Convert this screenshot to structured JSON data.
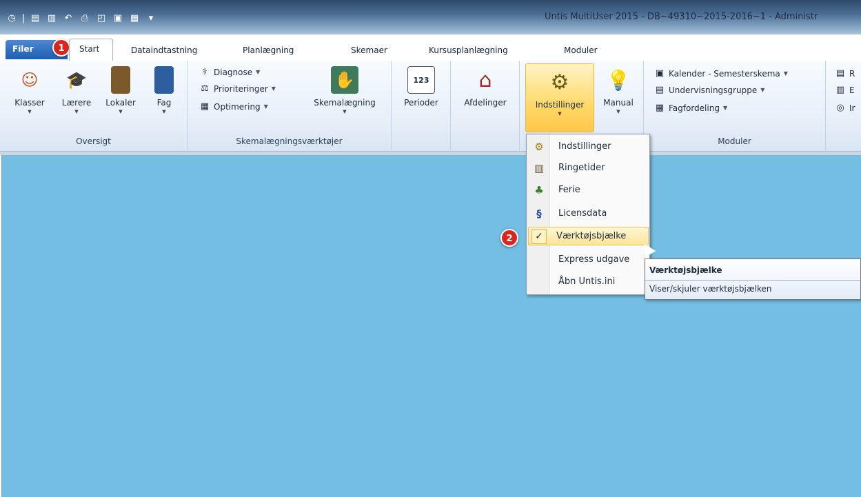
{
  "window": {
    "title": "Untis MultiUser 2015 - DB~49310~2015-2016~1 - Administr"
  },
  "tabs": [
    {
      "label": "Filer"
    },
    {
      "label": "Start"
    },
    {
      "label": "Dataindtastning"
    },
    {
      "label": "Planlægning"
    },
    {
      "label": "Skemaer"
    },
    {
      "label": "Kursusplanlægning"
    },
    {
      "label": "Moduler"
    }
  ],
  "callouts": [
    "1",
    "2"
  ],
  "ribbon": {
    "oversigt": {
      "label": "Oversigt",
      "buttons": [
        "Klasser",
        "Lærere",
        "Lokaler",
        "Fag"
      ]
    },
    "skema": {
      "label": "Skemalægningsværktøjer",
      "diagnose": "Diagnose",
      "prioriteringer": "Prioriteringer",
      "optimering": "Optimering",
      "skemalaegning": "Skemalægning"
    },
    "perioder": "Perioder",
    "perioder_icon_text": "123",
    "afdelinger": "Afdelinger",
    "indstillinger": "Indstillinger",
    "manual": "Manual",
    "moduler": {
      "label": "Moduler",
      "kalender": "Kalender - Semesterskema",
      "undervisning": "Undervisningsgruppe",
      "fagfordeling": "Fagfordeling"
    },
    "cut_items": [
      "R",
      "E",
      "Ir"
    ]
  },
  "menu": {
    "items": [
      {
        "label": "Indstillinger",
        "icon": "gear-icon"
      },
      {
        "label": "Ringetider",
        "icon": "timetable-icon"
      },
      {
        "label": "Ferie",
        "icon": "palm-tree-icon"
      },
      {
        "label": "Licensdata",
        "icon": "license-icon"
      },
      {
        "label": "Værktøjsbjælke",
        "icon": "checkmark-icon",
        "checked": true
      },
      {
        "label": "Express udgave"
      },
      {
        "label": "Åbn Untis.ini"
      }
    ]
  },
  "tooltip": {
    "title": "Værktøjsbjælke",
    "body": "Viser/skjuler værktøjsbjælken"
  }
}
